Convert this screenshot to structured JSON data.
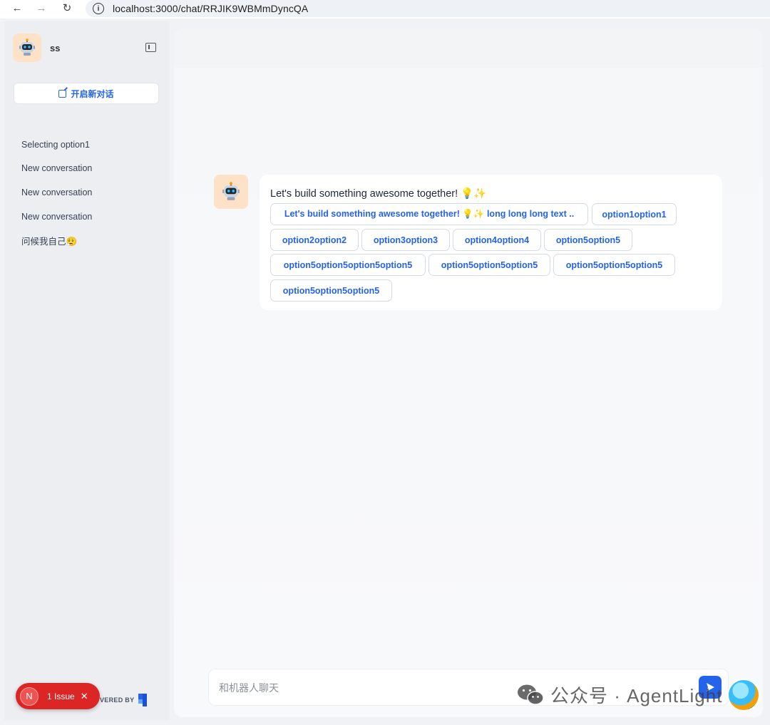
{
  "browser": {
    "url": "localhost:3000/chat/RRJIK9WBMmDyncQA",
    "info_icon": "i"
  },
  "sidebar": {
    "bot_name": "ss",
    "new_chat_label": "开启新对话",
    "conversations": [
      "Selecting option1",
      "New conversation",
      "New conversation",
      "New conversation",
      "问候我自己😮‍💨"
    ],
    "issue_badge": {
      "letter": "N",
      "label": "1 Issue",
      "close": "✕"
    },
    "powered_by": "VERED BY"
  },
  "chat": {
    "message": "Let's build something awesome together! 💡✨",
    "options": [
      "Let's build something awesome together! 💡✨ long long long text ..",
      "option1option1",
      "option2option2",
      "option3option3",
      "option4option4",
      "option5option5",
      "option5option5option5option5",
      "option5option5option5",
      "option5option5option5",
      "option5option5option5"
    ]
  },
  "input": {
    "placeholder": "和机器人聊天",
    "value": ""
  },
  "watermark": {
    "text": "公众号 · AgentLight"
  },
  "colors": {
    "accent": "#2563eb",
    "sidebar_bg": "#eceef2",
    "avatar_bg": "#fde2c8",
    "issue_red": "#dc2626"
  },
  "icons": {
    "back": "arrow-left-icon",
    "forward": "arrow-right-icon",
    "reload": "reload-icon",
    "info": "info-icon",
    "sidebar_toggle": "sidebar-toggle-icon",
    "new_chat": "edit-icon",
    "send": "send-icon",
    "bot": "robot-icon",
    "wechat": "wechat-icon"
  }
}
